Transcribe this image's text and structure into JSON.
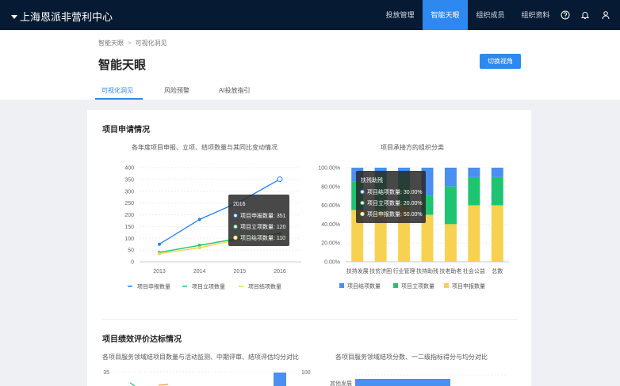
{
  "topbar": {
    "brand": "上海恩派非营利中心",
    "nav": [
      {
        "label": "投放管理",
        "active": false
      },
      {
        "label": "智能天眼",
        "active": true
      },
      {
        "label": "组织成员",
        "active": false
      },
      {
        "label": "组织资料",
        "active": false
      }
    ],
    "icons": [
      "help-icon",
      "bell-icon",
      "user-icon"
    ]
  },
  "header": {
    "breadcrumb": [
      "智能天眼",
      "可视化洞见"
    ],
    "title": "智能天眼",
    "switch_button": "切换视角",
    "tabs": [
      {
        "label": "可视化洞见",
        "active": true
      },
      {
        "label": "风险预警",
        "active": false
      },
      {
        "label": "AI投放指引",
        "active": false
      }
    ]
  },
  "section1": {
    "title": "项目申请情况",
    "left_chart_title": "各年度项目申报、立项、结项数量与其同比变动情况",
    "right_chart_title": "项目承接方的组织分类"
  },
  "section2": {
    "title": "项目绩效评价达标情况",
    "left_chart_title": "各项目服务领域结项目数量与活动监测、中期评审、结项评估均分对比",
    "right_chart_title": "各项目服务领域结项分数、一二级指标得分与均分对比",
    "left_axis_top": "35",
    "right_axis_top": "100",
    "bar_label": "其他发展"
  },
  "colors": {
    "blue": "#2d7ff0",
    "green": "#1fc472",
    "yellow": "#f7d250",
    "topbar": "#071a33"
  },
  "chart_data": [
    {
      "type": "line",
      "x": [
        "2013",
        "2014",
        "2015",
        "2016"
      ],
      "ylim": [
        0,
        400
      ],
      "yticks": [
        "0",
        "50",
        "100",
        "150",
        "200",
        "250",
        "300",
        "350",
        "400"
      ],
      "series": [
        {
          "name": "项目申报数量",
          "color": "#2d7ff0",
          "values": [
            75,
            180,
            255,
            351
          ]
        },
        {
          "name": "项目立项数量",
          "color": "#1fc472",
          "values": [
            40,
            70,
            100,
            120
          ]
        },
        {
          "name": "项目结项数量",
          "color": "#f7d250",
          "values": [
            35,
            60,
            95,
            110
          ]
        }
      ],
      "tooltip": {
        "title": "2016",
        "rows": [
          "项目申报数量: 351",
          "项目立项数量: 120",
          "项目结项数量: 110"
        ]
      }
    },
    {
      "type": "bar",
      "stacked": true,
      "categories": [
        "扶持发展",
        "扶贫济困",
        "行业管理",
        "扶持助残",
        "扶老助老",
        "社会公益",
        "总数"
      ],
      "ylim": [
        0,
        1
      ],
      "yticks": [
        "0.00%",
        "20.00%",
        "40.00%",
        "60.00%",
        "80.00%",
        "100.00%"
      ],
      "series": [
        {
          "name": "项目结项数量",
          "color": "#4b8ff0",
          "values": [
            0.15,
            0.1,
            0.1,
            0.3,
            0.2,
            0.1,
            0.1
          ]
        },
        {
          "name": "项目立项数量",
          "color": "#1fc472",
          "values": [
            0.3,
            0.35,
            0.3,
            0.2,
            0.4,
            0.3,
            0.3
          ]
        },
        {
          "name": "项目申报数量",
          "color": "#f7d250",
          "values": [
            0.55,
            0.55,
            0.6,
            0.5,
            0.4,
            0.6,
            0.6
          ]
        }
      ],
      "tooltip": {
        "title": "扶残助残",
        "rows": [
          "项目结项数量: 30.00%",
          "项目立项数量: 20.00%",
          "项目申报数量: 50.00%"
        ]
      }
    }
  ]
}
